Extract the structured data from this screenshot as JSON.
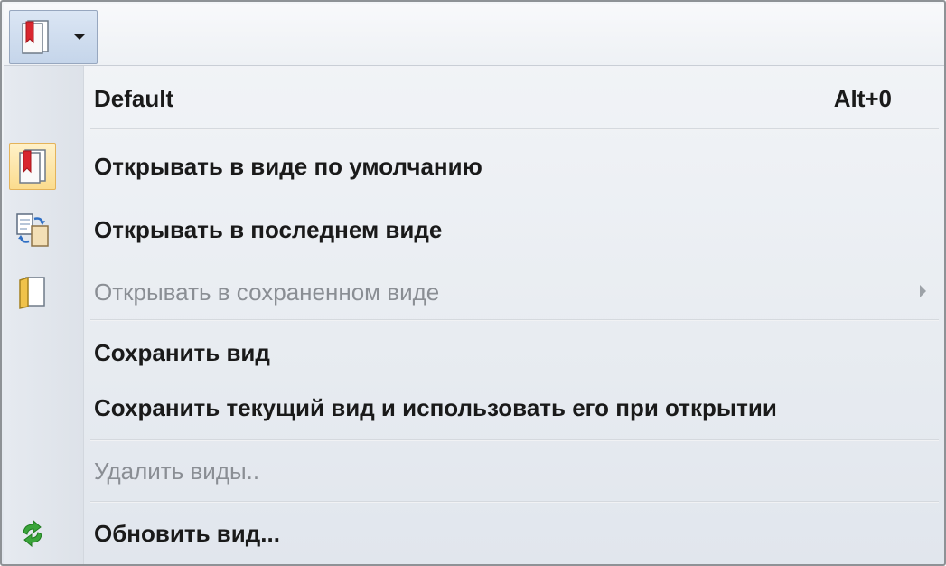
{
  "toolbar": {
    "button_icon": "bookmark-view-icon",
    "arrow_icon": "chevron-down-icon"
  },
  "menu": {
    "items": [
      {
        "label": "Default",
        "shortcut": "Alt+0",
        "enabled": true
      },
      {
        "label": "Открывать в виде по умолчанию",
        "icon": "bookmark-view-icon",
        "checked": true,
        "enabled": true
      },
      {
        "label": "Открывать в последнем виде",
        "icon": "last-view-icon",
        "enabled": true
      },
      {
        "label": "Открывать в сохраненном виде",
        "icon": "saved-view-icon",
        "enabled": false,
        "submenu": true
      },
      {
        "label": "Сохранить вид",
        "enabled": true
      },
      {
        "label": "Сохранить текущий вид и использовать его при открытии",
        "enabled": true
      },
      {
        "label": "Удалить виды..",
        "enabled": false
      },
      {
        "label": "Обновить вид...",
        "icon": "refresh-icon",
        "enabled": true
      }
    ]
  },
  "colors": {
    "checked_bg": "#fbdc8e",
    "checked_border": "#e4b35a",
    "disabled_text": "#8a8e94",
    "refresh_green": "#3aa53a",
    "bookmark_red": "#d9262e"
  }
}
